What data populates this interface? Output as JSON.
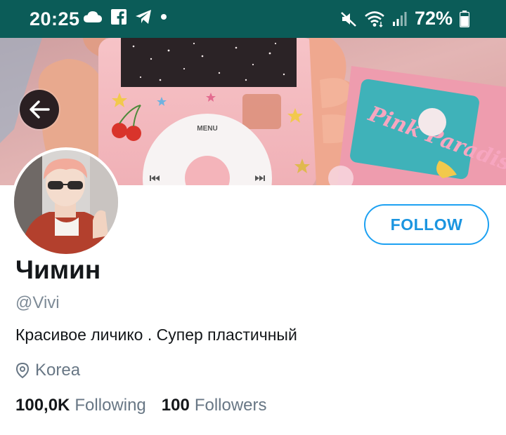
{
  "status_bar": {
    "time": "20:25",
    "left_icons": [
      "cloud-icon",
      "facebook-icon",
      "telegram-icon",
      "notification-dot-icon"
    ],
    "right_icons": [
      "mute-icon",
      "wifi-icon",
      "signal-icon",
      "battery-icon"
    ],
    "battery_percent": "72%"
  },
  "banner": {
    "description_icons": [
      "ipod-case-image"
    ],
    "menu_label": "MENU",
    "sticker_text": "Pink Paradise"
  },
  "profile": {
    "display_name": "Чимин",
    "handle": "@Vivi",
    "bio": "Красивое личико . Супер пластичный",
    "location": "Korea",
    "following_count": "100,0K",
    "following_label": "Following",
    "followers_count": "100",
    "followers_label": "Followers"
  },
  "actions": {
    "follow_label": "FOLLOW"
  },
  "colors": {
    "status_bar_bg": "#0b5c58",
    "accent": "#1da1f2"
  }
}
